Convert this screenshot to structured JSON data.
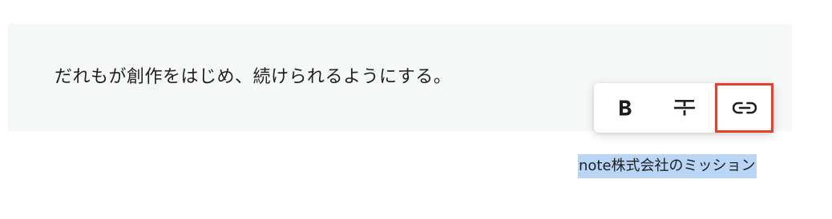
{
  "editor": {
    "quote_text": "だれもが創作をはじめ、続けられるようにする。",
    "caption_text": "note株式会社のミッション"
  },
  "toolbar": {
    "buttons": [
      {
        "name": "bold",
        "icon": "bold-icon"
      },
      {
        "name": "strikethrough",
        "icon": "strikethrough-icon"
      },
      {
        "name": "link",
        "icon": "link-icon",
        "highlighted": true
      }
    ]
  },
  "colors": {
    "quote_background": "#f6f8f7",
    "selection_highlight": "#b9d6f7",
    "highlight_border": "#e5402a",
    "text": "#1f1f1f"
  }
}
